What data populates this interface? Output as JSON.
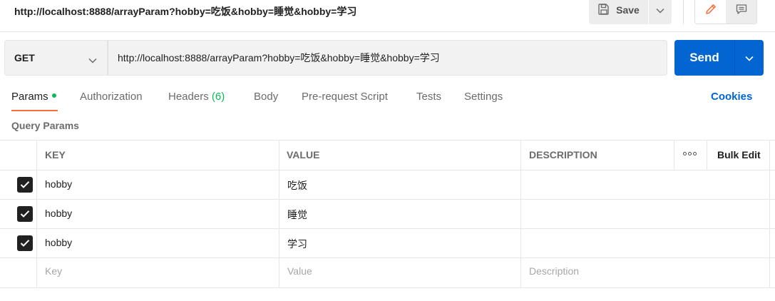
{
  "request": {
    "title": "http://localhost:8888/arrayParam?hobby=吃饭&hobby=睡觉&hobby=学习",
    "method": "GET",
    "url": "http://localhost:8888/arrayParam?hobby=吃饭&hobby=睡觉&hobby=学习"
  },
  "toolbar": {
    "save_label": "Save",
    "send_label": "Send"
  },
  "tabs": {
    "params": "Params",
    "authorization": "Authorization",
    "headers": "Headers",
    "headers_count": "(6)",
    "body": "Body",
    "prerequest": "Pre-request Script",
    "tests": "Tests",
    "settings": "Settings",
    "cookies": "Cookies"
  },
  "query_params": {
    "section_label": "Query Params",
    "columns": {
      "key": "KEY",
      "value": "VALUE",
      "description": "DESCRIPTION"
    },
    "bulk_edit_label": "Bulk Edit",
    "rows": [
      {
        "checked": true,
        "key": "hobby",
        "value": "吃饭",
        "description": ""
      },
      {
        "checked": true,
        "key": "hobby",
        "value": "睡觉",
        "description": ""
      },
      {
        "checked": true,
        "key": "hobby",
        "value": "学习",
        "description": ""
      }
    ],
    "placeholders": {
      "key": "Key",
      "value": "Value",
      "description": "Description"
    }
  },
  "colors": {
    "accent_orange": "#ff6c37",
    "send_blue": "#0265d2",
    "status_green": "#0cbb52"
  },
  "icons": [
    "save-icon",
    "chevron-down-icon",
    "pencil-icon",
    "comment-icon",
    "checkbox-checked-icon",
    "more-options-icon"
  ]
}
